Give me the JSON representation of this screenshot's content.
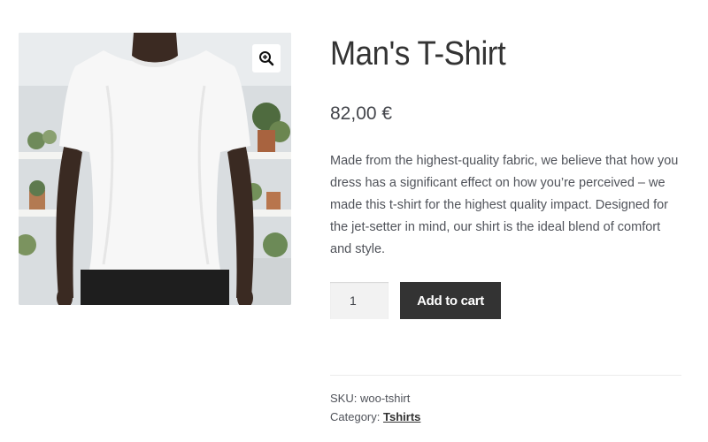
{
  "product": {
    "title": "Man's T-Shirt",
    "price": "82,00 €",
    "description": "Made from the highest-quality fabric, we believe that how you dress has a significant effect on how you’re perceived – we made this t-shirt for the highest quality impact. Designed for the jet-setter in mind, our shirt is the ideal blend of comfort and style.",
    "image_alt": "Man's T-Shirt"
  },
  "gallery": {
    "zoom_icon": "zoom-in-icon"
  },
  "cart": {
    "quantity": "1",
    "add_label": "Add to cart"
  },
  "meta": {
    "sku_label": "SKU:",
    "sku_value": "woo-tshirt",
    "category_label": "Category:",
    "category_value": "Tshirts"
  },
  "colors": {
    "button_bg": "#333333",
    "button_text": "#ffffff",
    "qty_bg": "#f2f2f2"
  }
}
